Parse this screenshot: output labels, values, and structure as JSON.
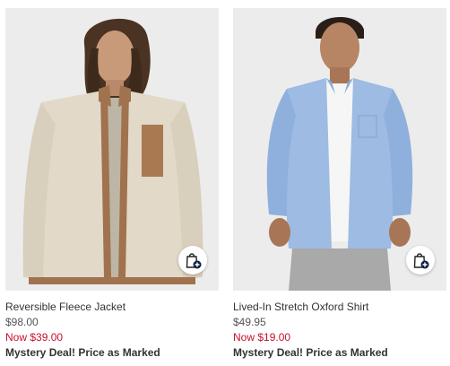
{
  "products": [
    {
      "name": "Reversible Fleece Jacket",
      "original_price": "$98.00",
      "sale_price": "Now $39.00",
      "promo": "Mystery Deal! Price as Marked",
      "image_icon": "product-photo"
    },
    {
      "name": "Lived-In Stretch Oxford Shirt",
      "original_price": "$49.95",
      "sale_price": "Now $19.00",
      "promo": "Mystery Deal! Price as Marked",
      "image_icon": "product-photo"
    }
  ],
  "quick_add_icon": "shopping-bag-plus-icon",
  "colors": {
    "sale": "#c8102e",
    "text": "#333333",
    "image_background": "#ebebeb",
    "quick_add_badge": "#0a2240"
  }
}
